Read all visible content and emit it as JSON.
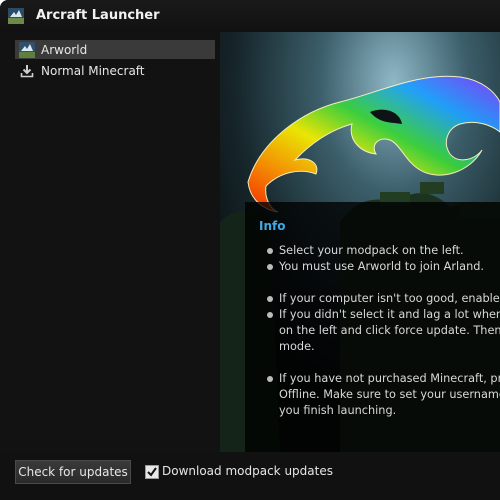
{
  "app": {
    "title": "Arcraft Launcher",
    "icon": "arcraft-logo-icon"
  },
  "sidebar": {
    "items": [
      {
        "label": "Arworld",
        "icon": "arworld-thumbnail-icon",
        "selected": true
      },
      {
        "label": "Normal Minecraft",
        "icon": "download-icon",
        "selected": false
      }
    ]
  },
  "info": {
    "title": "Info",
    "items": [
      {
        "lines": [
          "Select your modpack on the left."
        ]
      },
      {
        "lines": [
          "You must use Arworld to join Arland."
        ]
      },
      {
        "lines": [
          "If your computer isn't too good, enable \"L"
        ]
      },
      {
        "lines": [
          "If you didn't select it and lag a lot when pl",
          "on the left and click force update. Then, y",
          "mode."
        ]
      },
      {
        "lines": [
          "If you have not purchased Minecraft, pres",
          "Offline. Make sure to set your username",
          "you finish launching."
        ]
      }
    ]
  },
  "bottom": {
    "check_updates_label": "Check for updates",
    "download_checkbox": {
      "label": "Download modpack updates",
      "checked": true
    }
  },
  "colors": {
    "accent": "#3fa9e6",
    "background": "#141414"
  }
}
